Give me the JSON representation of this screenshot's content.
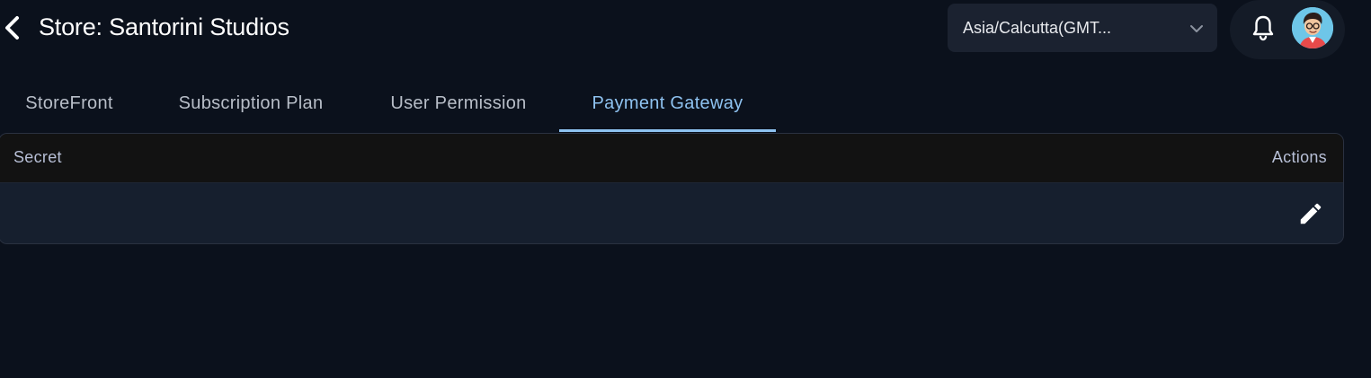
{
  "header": {
    "title": "Store: Santorini Studios",
    "back_icon": "chevron-left-icon"
  },
  "timezone": {
    "selected": "Asia/Calcutta(GMT...",
    "icon": "chevron-down-icon"
  },
  "user": {
    "bell_icon": "bell-icon",
    "avatar_icon": "avatar-illustration"
  },
  "tabs": [
    {
      "label": "StoreFront",
      "active": false
    },
    {
      "label": "Subscription Plan",
      "active": false
    },
    {
      "label": "User Permission",
      "active": false
    },
    {
      "label": "Payment Gateway",
      "active": true
    }
  ],
  "table": {
    "columns": [
      "Secret",
      "Actions"
    ],
    "rows": [
      {
        "secret": "",
        "action_icon": "pencil-icon"
      }
    ]
  },
  "colors": {
    "background": "#0b111c",
    "accent": "#8ec2f0",
    "select_bg": "#1b2230",
    "table_header_bg": "#121212",
    "table_row_bg": "#161f2e"
  }
}
